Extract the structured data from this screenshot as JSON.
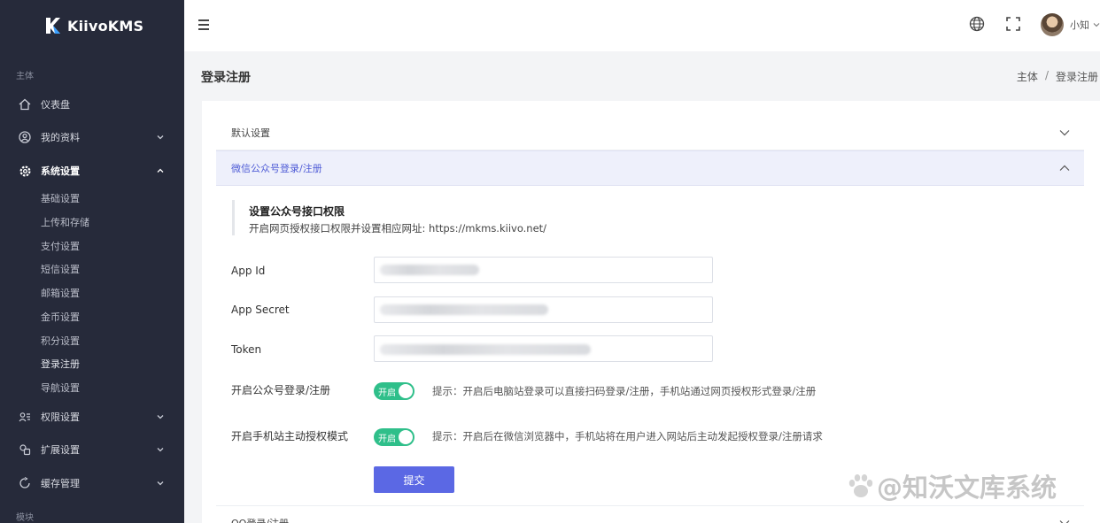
{
  "app": {
    "name": "KiivoKMS"
  },
  "sidebar": {
    "section_main": "主体",
    "section_modules": "模块",
    "items": [
      {
        "label": "仪表盘",
        "icon": "home-icon"
      },
      {
        "label": "我的资料",
        "icon": "user-circle-icon"
      },
      {
        "label": "系统设置",
        "icon": "gear-icon"
      },
      {
        "label": "权限设置",
        "icon": "permission-icon"
      },
      {
        "label": "扩展设置",
        "icon": "extension-icon"
      },
      {
        "label": "缓存管理",
        "icon": "cache-icon"
      }
    ],
    "sub_items": [
      "基础设置",
      "上传和存储",
      "支付设置",
      "短信设置",
      "邮箱设置",
      "金币设置",
      "积分设置",
      "登录注册",
      "导航设置"
    ]
  },
  "topbar": {
    "username": "小知"
  },
  "page": {
    "title": "登录注册",
    "breadcrumb": [
      "主体",
      "/",
      "登录注册"
    ]
  },
  "accordion": {
    "default_settings": "默认设置",
    "wechat": "微信公众号登录/注册",
    "qq": "QQ登录/注册"
  },
  "wechat_form": {
    "tip_title": "设置公众号接口权限",
    "tip_desc": "开启网页授权接口权限并设置相应网址: https://mkms.kiivo.net/",
    "app_id_label": "App Id",
    "app_secret_label": "App Secret",
    "token_label": "Token",
    "enable_label": "开启公众号登录/注册",
    "enable_switch": "开启",
    "enable_hint": "提示：开启后电脑站登录可以直接扫码登录/注册，手机站通过网页授权形式登录/注册",
    "mobile_label": "开启手机站主动授权模式",
    "mobile_switch": "开启",
    "mobile_hint": "提示：开启后在微信浏览器中，手机站将在用户进入网站后主动发起授权登录/注册请求",
    "submit": "提交"
  },
  "watermark": "@知沃文库系统"
}
